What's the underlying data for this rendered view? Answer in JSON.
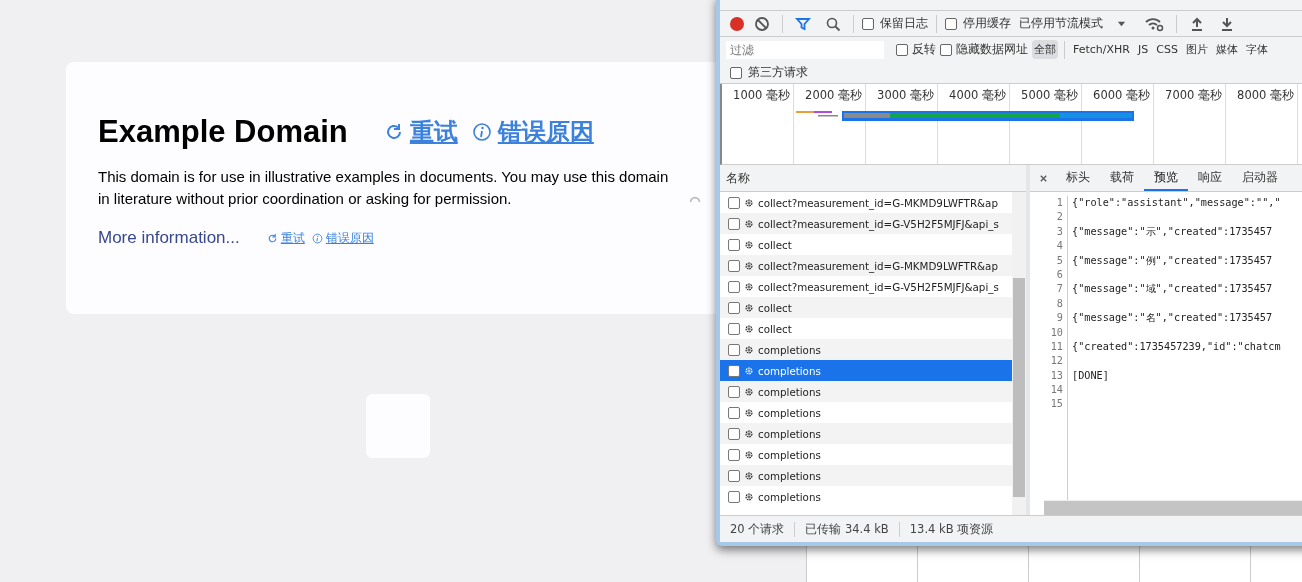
{
  "page": {
    "title": "Example Domain",
    "retry": "重试",
    "error_reason": "错误原因",
    "paragraph": "This domain is for use in illustrative examples in documents. You may use this domain in literature without prior coordination or asking for permission.",
    "more_info": "More information...",
    "small_retry": "重试",
    "small_error_reason": "错误原因"
  },
  "devtools": {
    "toolbar": {
      "recording": true,
      "checkboxes": [
        {
          "label": "保留日志",
          "checked": false
        },
        {
          "label": "停用缓存",
          "checked": false
        }
      ],
      "throttle": "已停用节流模式"
    },
    "filter": {
      "placeholder": "过滤",
      "checkboxes": [
        {
          "label": "反转",
          "checked": false
        },
        {
          "label": "隐藏数据网址",
          "checked": false
        }
      ],
      "types": [
        {
          "label": "全部",
          "selected": true
        },
        {
          "label": "Fetch/XHR",
          "selected": false
        },
        {
          "label": "JS",
          "selected": false
        },
        {
          "label": "CSS",
          "selected": false
        },
        {
          "label": "图片",
          "selected": false
        },
        {
          "label": "媒体",
          "selected": false
        },
        {
          "label": "字体",
          "selected": false
        }
      ],
      "third_party": {
        "label": "第三方请求",
        "checked": false
      }
    },
    "timeline": {
      "ticks": [
        "1000 毫秒",
        "2000 毫秒",
        "3000 毫秒",
        "4000 毫秒",
        "5000 毫秒",
        "6000 毫秒",
        "7000 毫秒",
        "8000 毫秒"
      ]
    },
    "requests": {
      "header": "名称",
      "rows": [
        {
          "name": "collect?measurement_id=G-MKMD9LWFTR&ap",
          "checked": false,
          "selected": false
        },
        {
          "name": "collect?measurement_id=G-V5H2F5MJFJ&api_s",
          "checked": false,
          "selected": false
        },
        {
          "name": "collect",
          "checked": false,
          "selected": false
        },
        {
          "name": "collect?measurement_id=G-MKMD9LWFTR&ap",
          "checked": false,
          "selected": false
        },
        {
          "name": "collect?measurement_id=G-V5H2F5MJFJ&api_s",
          "checked": false,
          "selected": false
        },
        {
          "name": "collect",
          "checked": false,
          "selected": false
        },
        {
          "name": "collect",
          "checked": false,
          "selected": false
        },
        {
          "name": "completions",
          "checked": false,
          "selected": false
        },
        {
          "name": "completions",
          "checked": false,
          "selected": true
        },
        {
          "name": "completions",
          "checked": false,
          "selected": false
        },
        {
          "name": "completions",
          "checked": false,
          "selected": false
        },
        {
          "name": "completions",
          "checked": false,
          "selected": false
        },
        {
          "name": "completions",
          "checked": false,
          "selected": false
        },
        {
          "name": "completions",
          "checked": false,
          "selected": false
        },
        {
          "name": "completions",
          "checked": false,
          "selected": false
        }
      ]
    },
    "detail": {
      "tabs": [
        {
          "label": "标头",
          "selected": false
        },
        {
          "label": "载荷",
          "selected": false
        },
        {
          "label": "预览",
          "selected": true
        },
        {
          "label": "响应",
          "selected": false
        },
        {
          "label": "启动器",
          "selected": false
        }
      ],
      "lines": [
        {
          "number": "1",
          "text": "{\"role\":\"assistant\",\"message\":\"\",\""
        },
        {
          "number": "2"
        },
        {
          "number": "3",
          "text": "{\"message\":\"示\",\"created\":1735457"
        },
        {
          "number": "4"
        },
        {
          "number": "5",
          "text": "{\"message\":\"例\",\"created\":1735457"
        },
        {
          "number": "6"
        },
        {
          "number": "7",
          "text": "{\"message\":\"域\",\"created\":1735457"
        },
        {
          "number": "8"
        },
        {
          "number": "9",
          "text": "{\"message\":\"名\",\"created\":1735457"
        },
        {
          "number": "10"
        },
        {
          "number": "11",
          "text": "{\"created\":1735457239,\"id\":\"chatcm"
        },
        {
          "number": "12"
        },
        {
          "number": "13",
          "text": "[DONE]"
        },
        {
          "number": "14"
        },
        {
          "number": "15"
        }
      ]
    },
    "status": [
      "20 个请求",
      "已传输 34.4 kB",
      "13.4 kB 项资源"
    ]
  }
}
